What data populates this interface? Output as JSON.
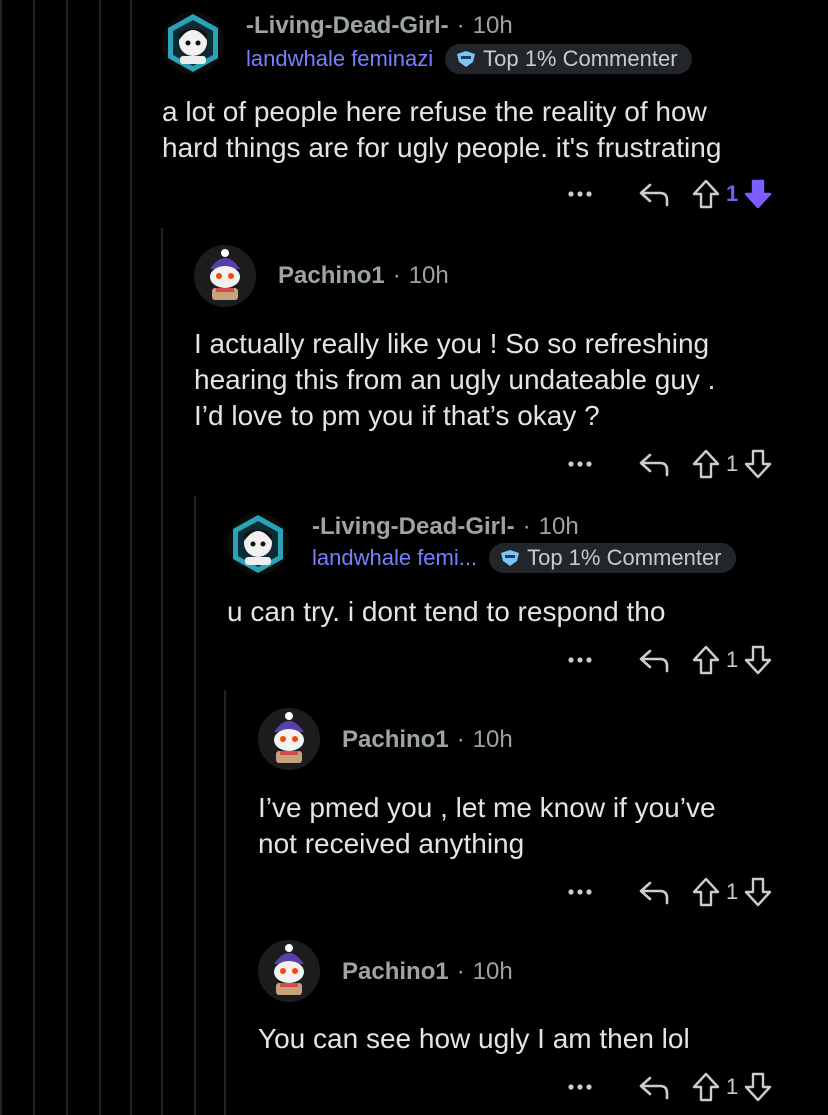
{
  "comments": [
    {
      "username": "-Living-Dead-Girl-",
      "time": "10h",
      "flair": "landwhale feminazi",
      "badge": "Top 1% Commenter",
      "text_lines": [
        "a lot of people here refuse the reality of how",
        "hard things are for ugly people. it's frustrating"
      ],
      "score": "1",
      "downvoted": true,
      "avatar": "avatar-living-dead-girl"
    },
    {
      "username": "Pachino1",
      "time": "10h",
      "text_lines": [
        "I actually really like you ! So so refreshing",
        "hearing this from an ugly undateable guy .",
        "I’d love to pm you if that’s okay ?"
      ],
      "score": "1",
      "avatar": "avatar-pachino1"
    },
    {
      "username": "-Living-Dead-Girl-",
      "time": "10h",
      "flair": "landwhale femi...",
      "badge": "Top 1% Commenter",
      "text_lines": [
        "u can try. i dont tend to respond tho"
      ],
      "score": "1",
      "avatar": "avatar-living-dead-girl"
    },
    {
      "username": "Pachino1",
      "time": "10h",
      "text_lines": [
        "I’ve pmed you , let me know if you’ve",
        "not received anything"
      ],
      "score": "1",
      "avatar": "avatar-pachino1"
    },
    {
      "username": "Pachino1",
      "time": "10h",
      "text_lines": [
        "You can see how ugly I am then lol"
      ],
      "score": "1",
      "avatar": "avatar-pachino1"
    }
  ],
  "colors": {
    "background": "#000000",
    "downvote_active": "#7a5cff",
    "flair": "#7880ff",
    "thread_line": "#1f2326"
  },
  "icons": [
    "more-icon",
    "reply-icon",
    "upvote-icon",
    "downvote-icon",
    "badge-icon"
  ]
}
